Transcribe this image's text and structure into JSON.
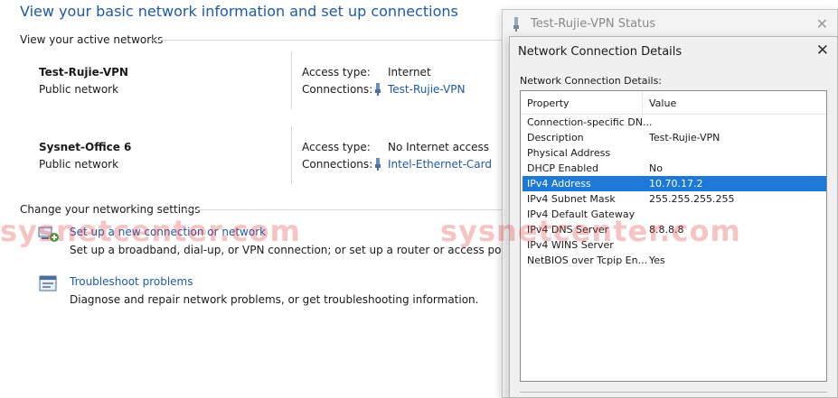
{
  "network_center": {
    "title": "View your basic network information and set up connections",
    "active_networks_heading": "View your active networks",
    "networks": [
      {
        "name": "Test-Rujie-VPN",
        "category": "Public network",
        "access_label": "Access type:",
        "access_value": "Internet",
        "connections_label": "Connections:",
        "connection": "Test-Rujie-VPN"
      },
      {
        "name": "Sysnet-Office 6",
        "category": "Public network",
        "access_label": "Access type:",
        "access_value": "No Internet access",
        "connections_label": "Connections:",
        "connection": "Intel-Ethernet-Card"
      }
    ],
    "change_heading": "Change your networking settings",
    "tasks": [
      {
        "link": "Set up a new connection or network",
        "desc": "Set up a broadband, dial-up, or VPN connection; or set up a router or access point."
      },
      {
        "link": "Troubleshoot problems",
        "desc": "Diagnose and repair network problems, or get troubleshooting information."
      }
    ]
  },
  "watermark": {
    "text_left": "sysnetcenter.com",
    "text_right": "sysnetcenter.com"
  },
  "status_window": {
    "title": "Test-Rujie-VPN Status",
    "close": "✕"
  },
  "details_dialog": {
    "title": "Network Connection Details",
    "close": "✕",
    "label": "Network Connection Details:",
    "columns": [
      "Property",
      "Value"
    ],
    "rows": [
      {
        "property": "Connection-specific DN...",
        "value": ""
      },
      {
        "property": "Description",
        "value": "Test-Rujie-VPN"
      },
      {
        "property": "Physical Address",
        "value": ""
      },
      {
        "property": "DHCP Enabled",
        "value": "No"
      },
      {
        "property": "IPv4 Address",
        "value": "10.70.17.2",
        "selected": true
      },
      {
        "property": "IPv4 Subnet Mask",
        "value": "255.255.255.255"
      },
      {
        "property": "IPv4 Default Gateway",
        "value": ""
      },
      {
        "property": "IPv4 DNS Server",
        "value": "8.8.8.8"
      },
      {
        "property": "IPv4 WINS Server",
        "value": ""
      },
      {
        "property": "NetBIOS over Tcpip En...",
        "value": "Yes"
      }
    ]
  },
  "colors": {
    "link": "#1e5aa8",
    "selection": "#1e78d7",
    "watermark": "#e63c3c"
  },
  "icons": {
    "connection": "vpn-adapter-icon",
    "new_connection": "network-setup-icon",
    "troubleshoot": "troubleshoot-icon",
    "status": "adapter-icon"
  }
}
